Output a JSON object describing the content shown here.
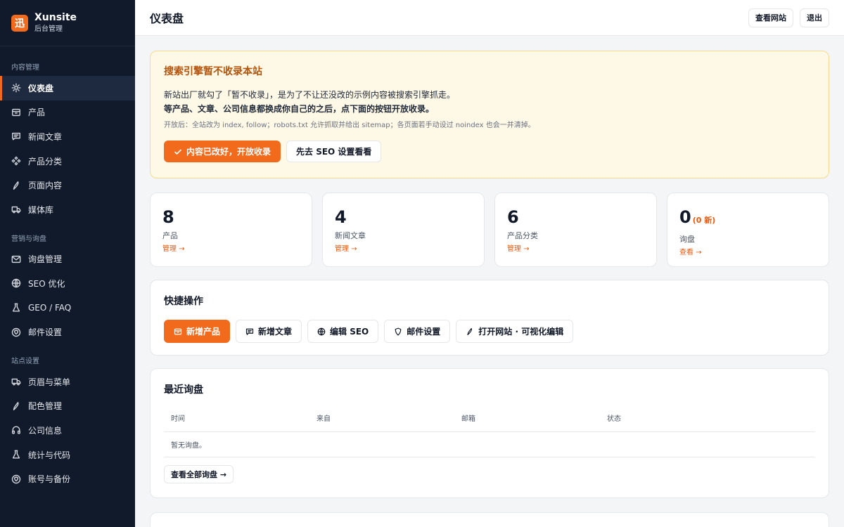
{
  "brand": {
    "logo_char": "迅",
    "name": "Xunsite",
    "subtitle": "后台管理"
  },
  "sidebar": {
    "groups": [
      {
        "label": "内容管理",
        "items": [
          {
            "label": "仪表盘",
            "icon": "dashboard-icon",
            "active": true
          },
          {
            "label": "产品",
            "icon": "box-icon"
          },
          {
            "label": "新闻文章",
            "icon": "message-icon"
          },
          {
            "label": "产品分类",
            "icon": "categories-icon"
          },
          {
            "label": "页面内容",
            "icon": "pen-icon"
          },
          {
            "label": "媒体库",
            "icon": "truck-icon"
          }
        ]
      },
      {
        "label": "营销与询盘",
        "items": [
          {
            "label": "询盘管理",
            "icon": "mail-icon"
          },
          {
            "label": "SEO 优化",
            "icon": "globe-icon"
          },
          {
            "label": "GEO / FAQ",
            "icon": "flask-icon"
          },
          {
            "label": "邮件设置",
            "icon": "shield-icon"
          }
        ]
      },
      {
        "label": "站点设置",
        "items": [
          {
            "label": "页眉与菜单",
            "icon": "truck-icon"
          },
          {
            "label": "配色管理",
            "icon": "pen-icon"
          },
          {
            "label": "公司信息",
            "icon": "headphones-icon"
          },
          {
            "label": "统计与代码",
            "icon": "flask-icon"
          },
          {
            "label": "账号与备份",
            "icon": "shield-icon"
          }
        ]
      }
    ]
  },
  "topbar": {
    "title": "仪表盘",
    "view_site": "查看网站",
    "logout": "退出"
  },
  "notice": {
    "title": "搜索引擎暂不收录本站",
    "line1": "新站出厂就勾了「暂不收录」，是为了不让还没改的示例内容被搜索引擎抓走。",
    "line2": "等产品、文章、公司信息都换成你自己的之后，点下面的按钮开放收录。",
    "note": "开放后：全站改为 index, follow；robots.txt 允许抓取并给出 sitemap；各页面若手动设过 noindex 也会一并清掉。",
    "primary_button": "内容已改好，开放收录",
    "secondary_button": "先去 SEO 设置看看"
  },
  "stats": [
    {
      "value": "8",
      "extra": "",
      "label": "产品",
      "link": "管理 →"
    },
    {
      "value": "4",
      "extra": "",
      "label": "新闻文章",
      "link": "管理 →"
    },
    {
      "value": "6",
      "extra": "",
      "label": "产品分类",
      "link": "管理 →"
    },
    {
      "value": "0",
      "extra": "(0 新)",
      "label": "询盘",
      "link": "查看 →"
    }
  ],
  "quick": {
    "title": "快捷操作",
    "actions": [
      {
        "label": "新增产品",
        "icon": "box-icon",
        "primary": true
      },
      {
        "label": "新增文章",
        "icon": "message-icon"
      },
      {
        "label": "编辑 SEO",
        "icon": "globe-icon"
      },
      {
        "label": "邮件设置",
        "icon": "shield-icon"
      },
      {
        "label": "打开网站 · 可视化编辑",
        "icon": "pen-icon"
      }
    ]
  },
  "inquiries": {
    "title": "最近询盘",
    "columns": [
      "时间",
      "来自",
      "邮箱",
      "状态"
    ],
    "empty": "暂无询盘。",
    "view_all": "查看全部询盘 →"
  },
  "colors": {
    "accent": "#f26b1d",
    "sidebar_bg": "#111a2b",
    "notice_bg": "#fef8e7"
  }
}
